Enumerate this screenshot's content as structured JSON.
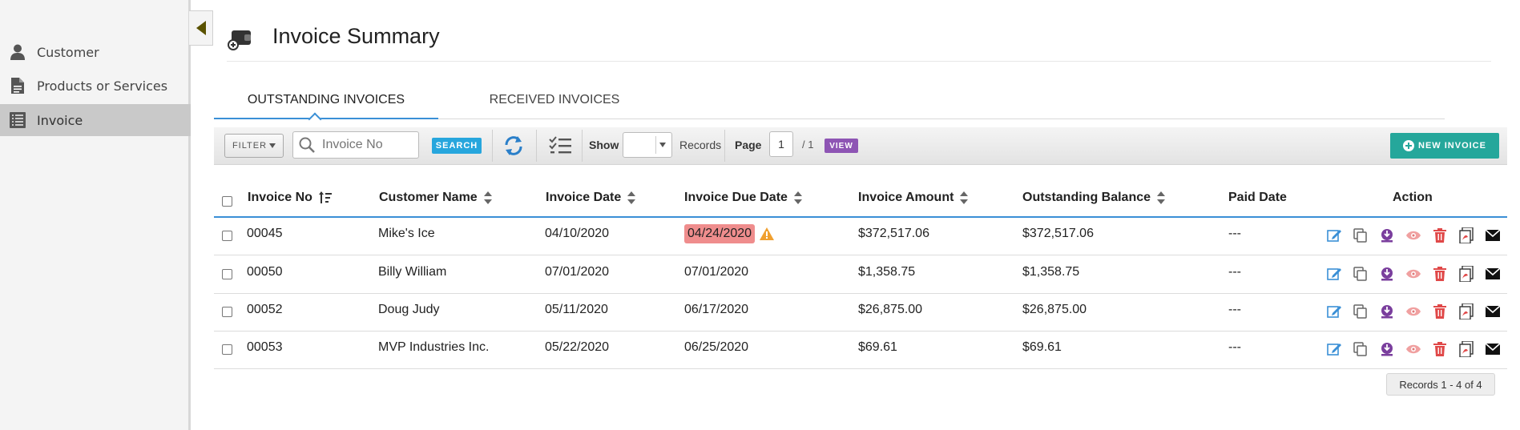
{
  "sidebar": {
    "items": [
      {
        "label": "Customer",
        "icon": "user-icon",
        "active": false
      },
      {
        "label": "Products or Services",
        "icon": "document-icon",
        "active": false
      },
      {
        "label": "Invoice",
        "icon": "invoice-list-icon",
        "active": true
      }
    ]
  },
  "header": {
    "title": "Invoice Summary",
    "icon": "wallet-add-icon"
  },
  "tabs": [
    {
      "label": "OUTSTANDING INVOICES",
      "active": true
    },
    {
      "label": "RECEIVED INVOICES",
      "active": false
    }
  ],
  "toolbar": {
    "filter_label": "FILTER",
    "search_placeholder": "Invoice No",
    "search_label": "SEARCH",
    "show_label": "Show",
    "records_label": "Records",
    "page_label": "Page",
    "page_value": "1",
    "page_total": "/ 1",
    "view_label": "VIEW",
    "new_invoice_label": "NEW INVOICE"
  },
  "table": {
    "columns": [
      "Invoice No",
      "Customer Name",
      "Invoice Date",
      "Invoice Due Date",
      "Invoice Amount",
      "Outstanding Balance",
      "Paid Date",
      "Action"
    ],
    "rows": [
      {
        "invoice_no": "00045",
        "customer": "Mike's Ice",
        "invoice_date": "04/10/2020",
        "due_date": "04/24/2020",
        "amount": "$372,517.06",
        "balance": "$372,517.06",
        "paid_date": "---",
        "overdue": true
      },
      {
        "invoice_no": "00050",
        "customer": "Billy William",
        "invoice_date": "07/01/2020",
        "due_date": "07/01/2020",
        "amount": "$1,358.75",
        "balance": "$1,358.75",
        "paid_date": "---",
        "overdue": false
      },
      {
        "invoice_no": "00052",
        "customer": "Doug Judy",
        "invoice_date": "05/11/2020",
        "due_date": "06/17/2020",
        "amount": "$26,875.00",
        "balance": "$26,875.00",
        "paid_date": "---",
        "overdue": false
      },
      {
        "invoice_no": "00053",
        "customer": "MVP Industries Inc.",
        "invoice_date": "05/22/2020",
        "due_date": "06/25/2020",
        "amount": "$69.61",
        "balance": "$69.61",
        "paid_date": "---",
        "overdue": false
      }
    ],
    "action_icons": [
      "edit-icon",
      "copy-icon",
      "download-icon",
      "view-icon",
      "delete-icon",
      "pdf-icon",
      "email-icon"
    ]
  },
  "footer": {
    "records_text": "Records 1 - 4 of 4"
  },
  "colors": {
    "accent_blue": "#3a8fd6",
    "search_button": "#27a6dd",
    "view_button": "#8e55b4",
    "new_invoice_button": "#25a79b",
    "overdue_highlight": "#ef8d8d",
    "warning": "#f0a030"
  }
}
